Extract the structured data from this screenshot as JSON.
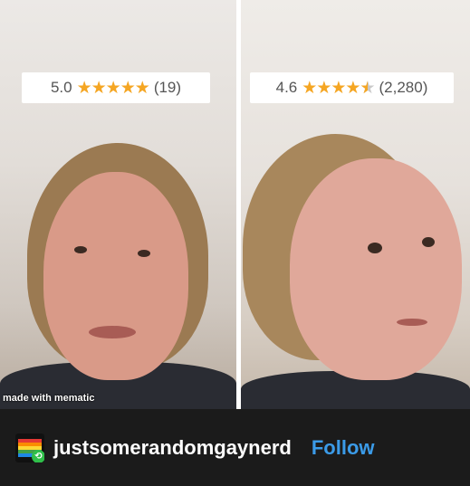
{
  "left_panel": {
    "rating_value": "5.0",
    "rating_stars": 5,
    "review_count": "(19)",
    "watermark": "made with mematic"
  },
  "right_panel": {
    "rating_value": "4.6",
    "rating_stars": 4.6,
    "review_count": "(2,280)"
  },
  "post": {
    "username": "justsomerandomgaynerd",
    "follow_label": "Follow"
  },
  "colors": {
    "star": "#f5a623",
    "follow": "#3b9be8",
    "footer_bg": "#1b1b1b"
  }
}
